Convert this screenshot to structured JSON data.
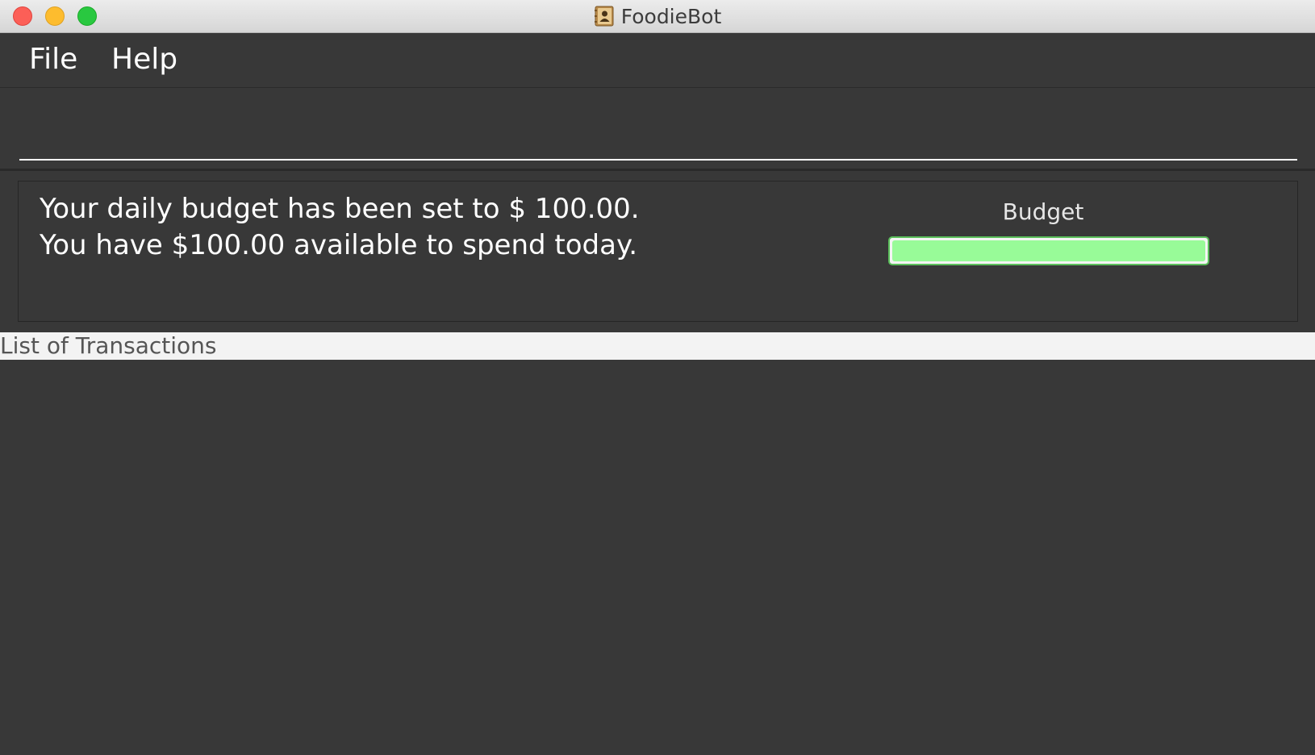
{
  "window": {
    "title": "FoodieBot",
    "app_icon": "contacts-book-icon"
  },
  "menu": {
    "items": [
      {
        "label": "File"
      },
      {
        "label": "Help"
      }
    ]
  },
  "command_box": {
    "value": "",
    "placeholder": ""
  },
  "result": {
    "lines": [
      "Your daily budget has been set to $ 100.00.",
      "You have $100.00 available to spend today."
    ]
  },
  "budget": {
    "label": "Budget",
    "remaining_fraction": 1.0,
    "bar_color": "#98fb98"
  },
  "transactions": {
    "header": "List of Transactions",
    "items": []
  }
}
